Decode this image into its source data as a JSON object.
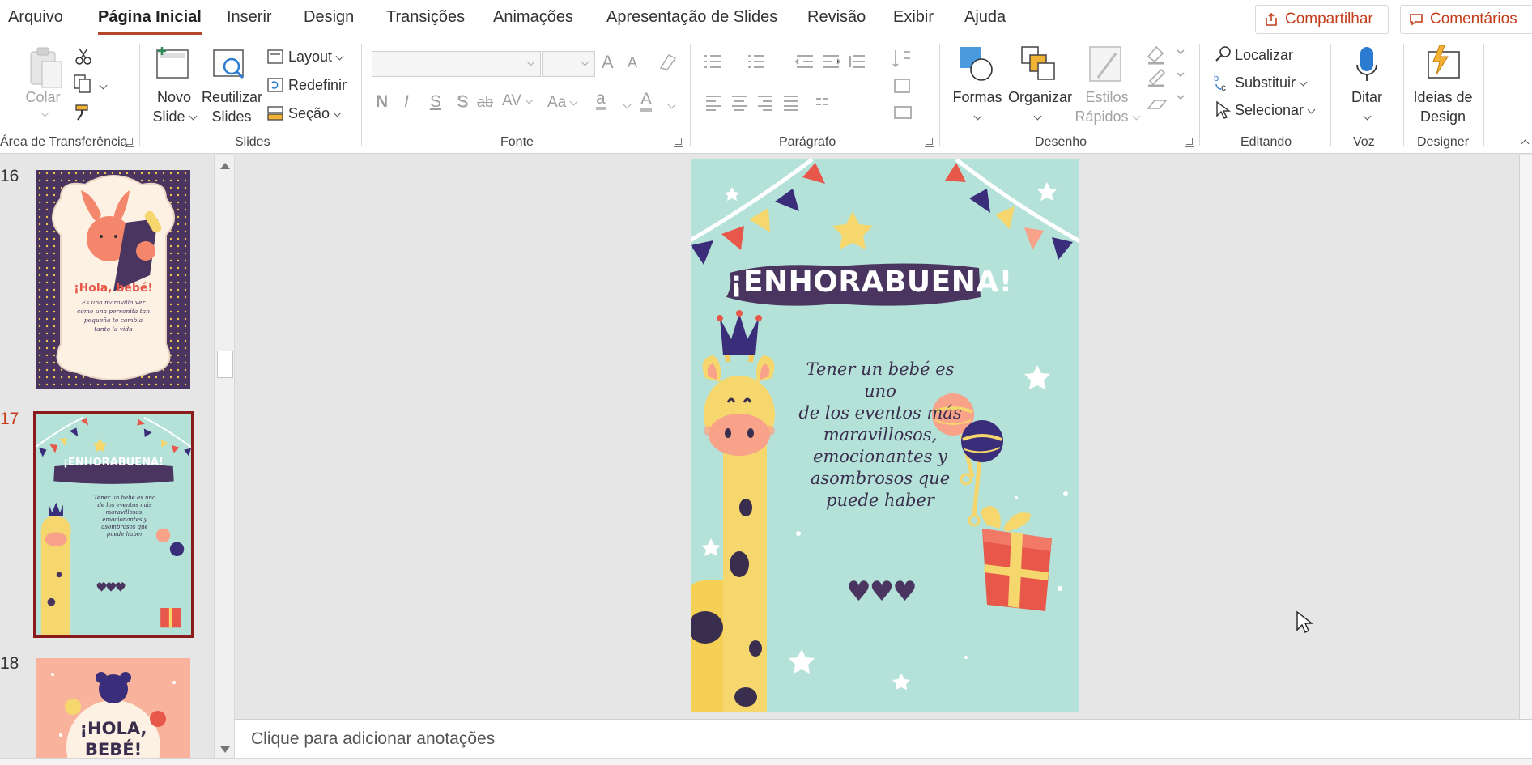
{
  "tabs": [
    "Arquivo",
    "Página Inicial",
    "Inserir",
    "Design",
    "Transições",
    "Animações",
    "Apresentação de Slides",
    "Revisão",
    "Exibir",
    "Ajuda"
  ],
  "header_buttons": {
    "share": "Compartilhar",
    "comments": "Comentários"
  },
  "ribbon": {
    "clipboard": {
      "paste": "Colar",
      "label": "Área de Transferência"
    },
    "slides": {
      "new_slide_line1": "Novo",
      "new_slide_line2": "Slide",
      "reuse_line1": "Reutilizar",
      "reuse_line2": "Slides",
      "layout": "Layout",
      "reset": "Redefinir",
      "section": "Seção",
      "label": "Slides"
    },
    "font": {
      "bold": "N",
      "italic": "I",
      "underline": "S",
      "shadow": "S",
      "strike": "ab",
      "spacing": "AV",
      "case": "Aa",
      "highlight": "a",
      "color": "A",
      "grow": "A",
      "shrink": "A",
      "label": "Fonte"
    },
    "paragraph": {
      "label": "Parágrafo"
    },
    "drawing": {
      "shapes": "Formas",
      "arrange": "Organizar",
      "styles_line1": "Estilos",
      "styles_line2": "Rápidos",
      "label": "Desenho"
    },
    "editing": {
      "find": "Localizar",
      "replace": "Substituir",
      "select": "Selecionar",
      "label": "Editando"
    },
    "voice": {
      "dictate": "Ditar",
      "label": "Voz"
    },
    "designer": {
      "ideas_line1": "Ideias de",
      "ideas_line2": "Design",
      "label": "Designer"
    }
  },
  "thumbnails": {
    "numbers": [
      "16",
      "17",
      "18"
    ],
    "slide16": {
      "title": "¡Hola, bebé!",
      "line1": "Es una maravilla ver",
      "line2": "cómo una personita tan",
      "line3": "pequeña te cambia",
      "line4": "tanto la vida"
    },
    "slide17": {
      "title": "¡ENHORABUENA!"
    },
    "slide18": {
      "line1": "¡HOLA,",
      "line2": "BEBÉ!"
    }
  },
  "slide": {
    "title": "¡ENHORABUENA!",
    "body": [
      "Tener un bebé es uno",
      "de los eventos más",
      "maravillosos,",
      "emocionantes y",
      "asombrosos que",
      "puede haber"
    ],
    "hearts": "♥♥♥"
  },
  "notes_placeholder": "Clique para adicionar anotações",
  "colors": {
    "accent": "#b7472a",
    "slide_bg": "#b4e2d8",
    "banner": "#4a3560",
    "navy": "#3a2e7a"
  }
}
